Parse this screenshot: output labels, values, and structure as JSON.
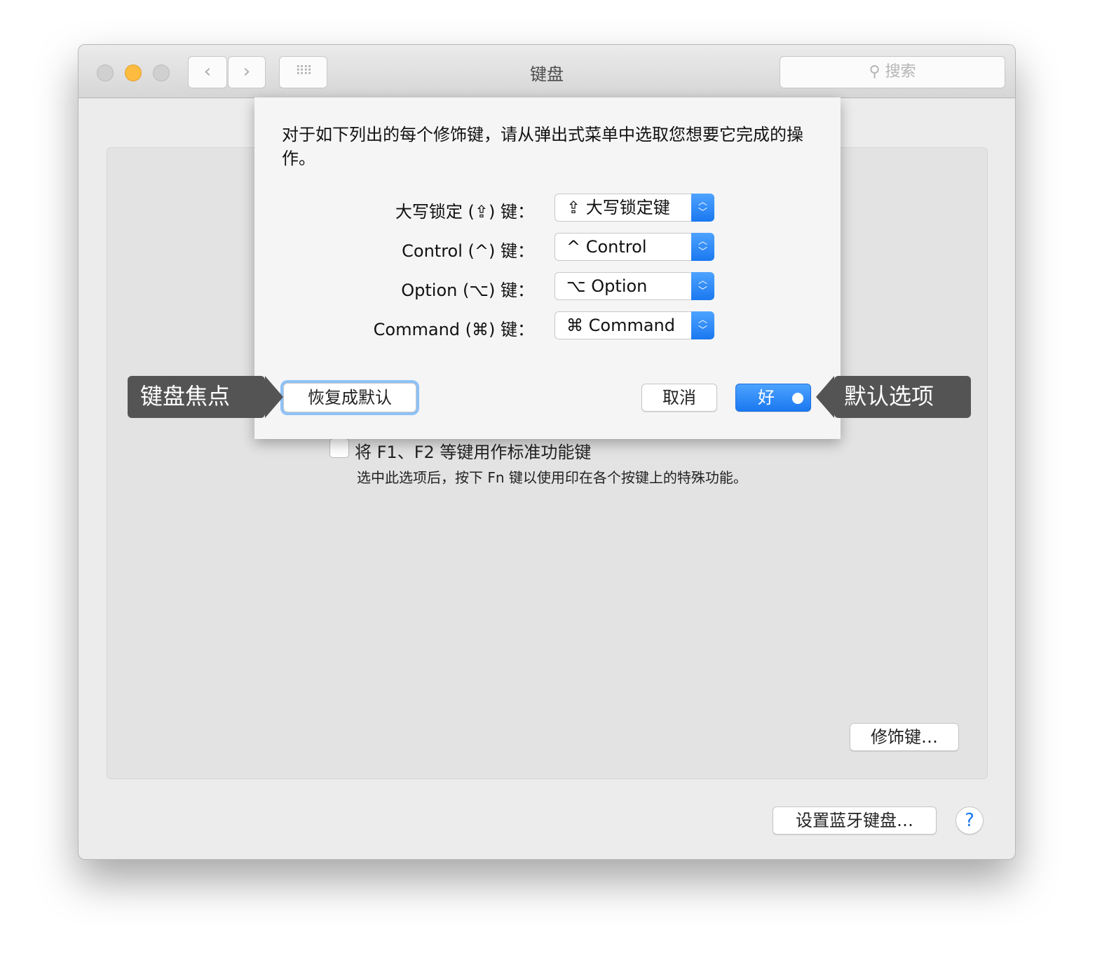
{
  "window": {
    "title": "键盘",
    "search_placeholder": "搜索",
    "back_icon": "chevron-left-icon",
    "forward_icon": "chevron-right-icon",
    "grid_icon": "grid-icon"
  },
  "sheet": {
    "intro": "对于如下列出的每个修饰键，请从弹出式菜单中选取您想要它完成的操作。",
    "rows": [
      {
        "label": "大写锁定 (⇪) 键：",
        "value": "⇪ 大写锁定键"
      },
      {
        "label": "Control (^) 键：",
        "value": "^ Control"
      },
      {
        "label": "Option (⌥) 键：",
        "value": "⌥ Option"
      },
      {
        "label": "Command (⌘) 键：",
        "value": "⌘ Command"
      }
    ],
    "restore_label": "恢复成默认",
    "cancel_label": "取消",
    "ok_label": "好"
  },
  "panel": {
    "checkbox_label": "将 F1、F2 等键用作标准功能键",
    "checkbox_checked": false,
    "checkbox_desc": "选中此选项后，按下 Fn 键以使用印在各个按键上的特殊功能。",
    "modifier_button": "修饰键…"
  },
  "footer": {
    "bluetooth_button": "设置蓝牙键盘…",
    "help": "?"
  },
  "callouts": {
    "left": "键盘焦点",
    "right": "默认选项"
  },
  "colors": {
    "accent": "#1a78f0",
    "minimize": "#fdbc40",
    "callout": "#545454"
  }
}
